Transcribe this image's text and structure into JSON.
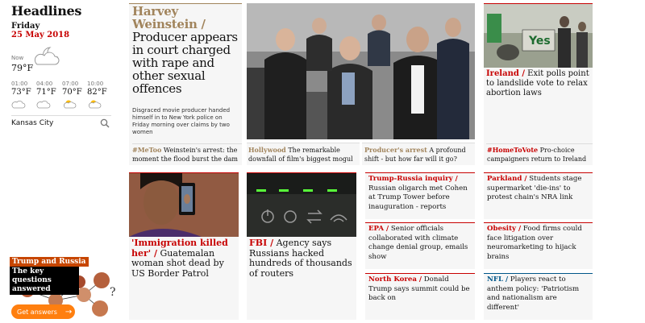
{
  "sidebar": {
    "title": "Headlines",
    "day": "Friday",
    "date": "25 May 2018",
    "weather": {
      "now_label": "Now",
      "now_temp": "79°F",
      "now_icon": "partly-cloudy-night-icon",
      "forecast": [
        {
          "time": "01:00",
          "temp": "73°F",
          "icon": "cloud-icon"
        },
        {
          "time": "04:00",
          "temp": "71°F",
          "icon": "cloud-icon"
        },
        {
          "time": "07:00",
          "temp": "70°F",
          "icon": "sun-cloud-icon"
        },
        {
          "time": "10:00",
          "temp": "82°F",
          "icon": "sun-cloud-icon"
        }
      ],
      "location": "Kansas City"
    },
    "promo": {
      "label": "Trump and Russia",
      "sub": "The key questions answered",
      "button": "Get answers"
    }
  },
  "stories": {
    "lead": {
      "kicker": "Harvey Weinstein /",
      "headline": "Producer appears in court charged with rape and other sexual offences",
      "standfirst": "Disgraced movie producer handed himself in to New York police on Friday morning over claims by two women"
    },
    "lead_subs": [
      {
        "kicker": "#MeToo",
        "text": "Weinstein's arrest: the moment the flood burst the dam"
      },
      {
        "kicker": "Hollywood",
        "text": "The remarkable downfall of film's biggest mogul"
      },
      {
        "kicker": "Producer's arrest",
        "text": "A profound shift - but how far will it go?"
      }
    ],
    "ireland": {
      "kicker": "Ireland /",
      "headline": "Exit polls point to landslide vote to relax abortion laws",
      "sub_kicker": "#HomeToVote",
      "sub_text": "Pro-choice campaigners return to Ireland",
      "sign_text": "Yes"
    },
    "immigration": {
      "kicker": "'Immigration killed her' /",
      "headline": "Guatemalan woman shot dead by US Border Patrol"
    },
    "fbi": {
      "kicker": "FBI /",
      "headline": "Agency says Russians hacked hundreds of thousands of routers"
    },
    "col3": [
      {
        "kicker": "Trump-Russia inquiry /",
        "text": "Russian oligarch met Cohen at Trump Tower before inauguration - reports"
      },
      {
        "kicker": "EPA /",
        "text": "Senior officials collaborated with climate change denial group, emails show"
      },
      {
        "kicker": "North Korea /",
        "text": "Donald Trump says summit could be back on"
      }
    ],
    "col4": [
      {
        "kicker": "Parkland /",
        "text": "Students stage supermarket 'die-ins' to protest chain's NRA link"
      },
      {
        "kicker": "Obesity /",
        "text": "Food firms could face litigation over neuromarketing to hijack brains"
      },
      {
        "kicker": "NFL /",
        "text": "Players react to anthem policy: 'Patriotism and nationalism are different'"
      }
    ]
  },
  "colors": {
    "news_red": "#c70000",
    "culture_tan": "#a1845c",
    "sport_blue": "#005689",
    "promo_orange": "#ff7f0f"
  }
}
